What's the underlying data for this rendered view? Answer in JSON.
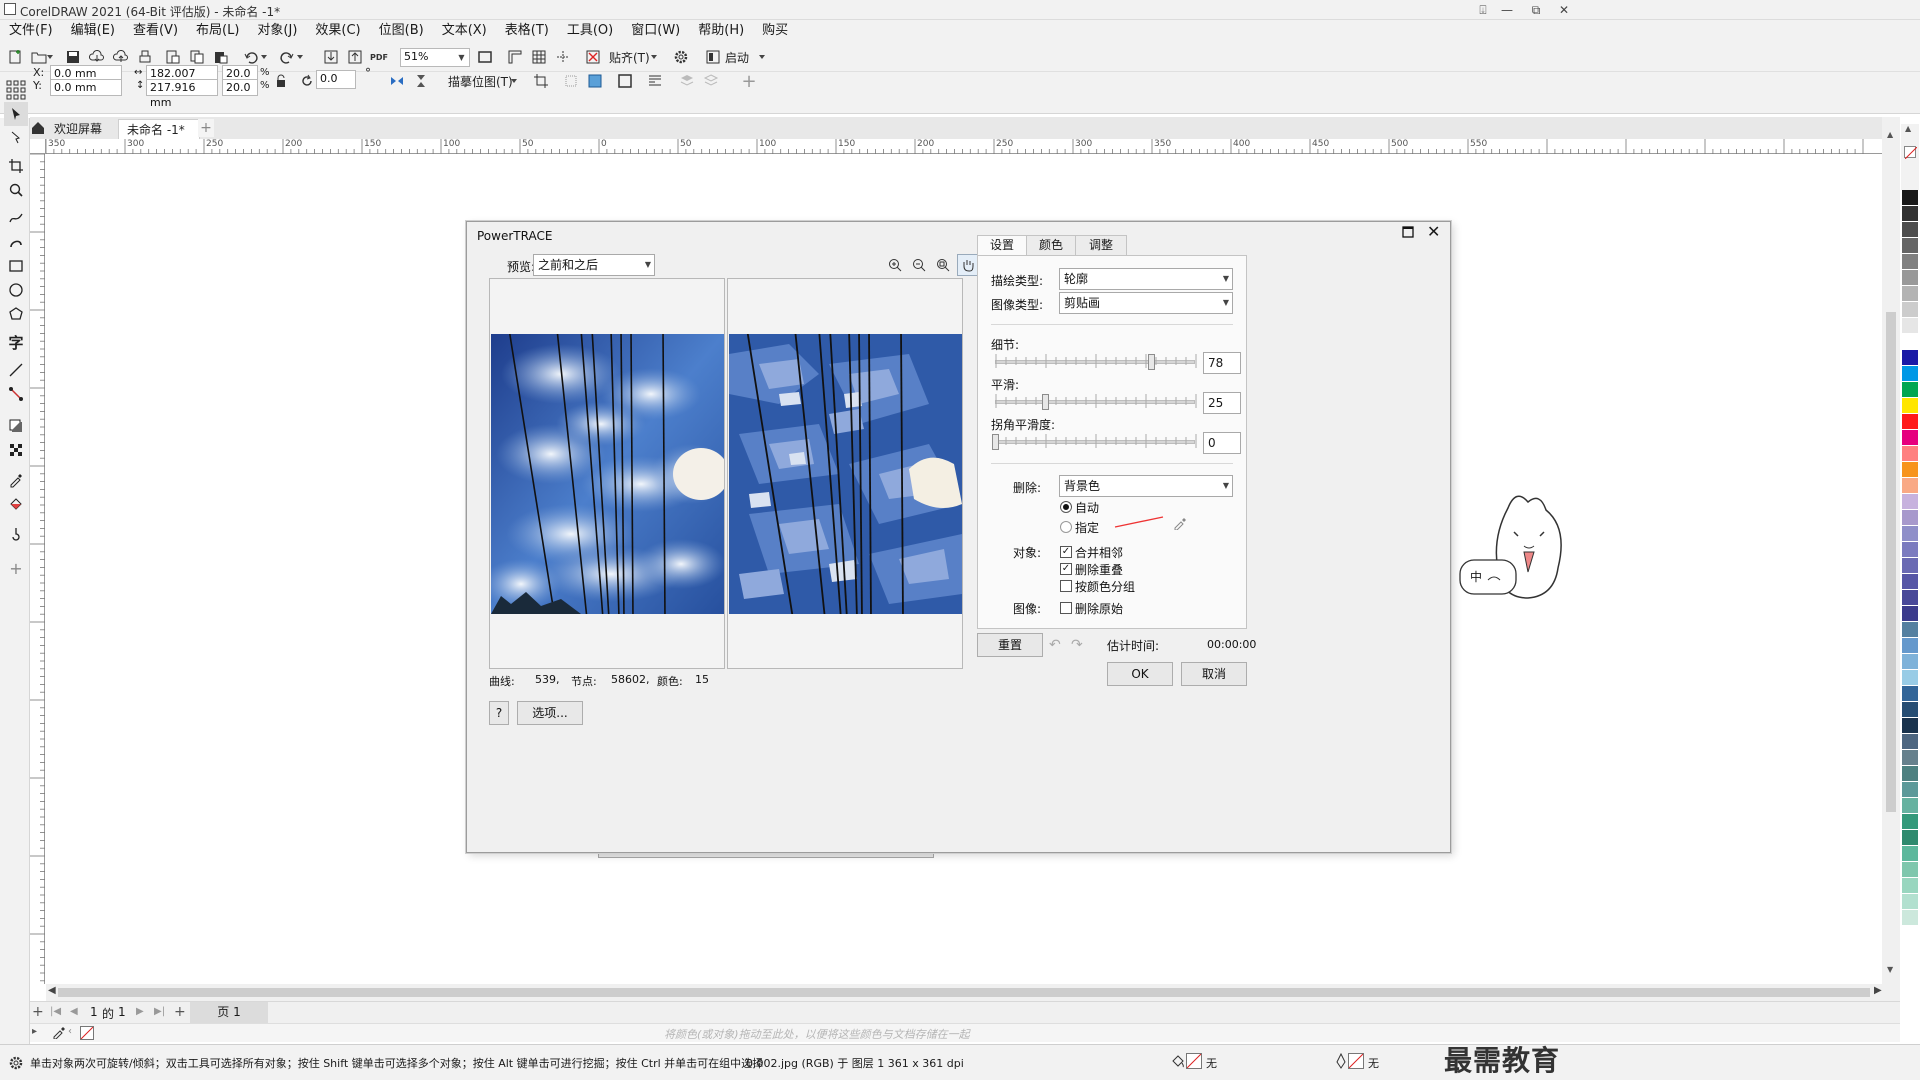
{
  "window": {
    "title": "CorelDRAW 2021 (64-Bit 评估版) - 未命名 -1*",
    "min_label": "—",
    "max_label": "☐",
    "close_label": "✕",
    "restore_label": "⧉"
  },
  "menu": [
    "文件(F)",
    "编辑(E)",
    "查看(V)",
    "布局(L)",
    "对象(J)",
    "效果(C)",
    "位图(B)",
    "文本(X)",
    "表格(T)",
    "工具(O)",
    "窗口(W)",
    "帮助(H)",
    "购买"
  ],
  "toolbar1": {
    "zoom": "51%",
    "snap_label": "贴齐(T)",
    "launch_label": "启动",
    "pdf_label": "PDF"
  },
  "toolbar2": {
    "x_label": "X:",
    "y_label": "Y:",
    "x_value": "0.0 mm",
    "y_value": "0.0 mm",
    "width_value": "182.007 mm",
    "height_value": "217.916 mm",
    "scale_w": "20.0",
    "scale_h": "20.0",
    "percent": "%",
    "rotation": "0.0",
    "degree": "°",
    "trace_label": "描摹位图(T)"
  },
  "doc_tabs": {
    "welcome": "欢迎屏幕",
    "doc": "未命名 -1*"
  },
  "ruler": {
    "h_labels": [
      "350",
      "300",
      "250",
      "200",
      "150",
      "100",
      "50",
      "0",
      "50",
      "100",
      "150",
      "200",
      "250",
      "300",
      "350",
      "400",
      "450",
      "500",
      "550"
    ],
    "unit": "毫米"
  },
  "dialog": {
    "title": "PowerTRACE",
    "preview_label": "预览:",
    "preview_value": "之前和之后",
    "tabs": [
      "设置",
      "颜色",
      "调整"
    ],
    "trace_type_label": "描绘类型:",
    "trace_type_value": "轮廓",
    "image_type_label": "图像类型:",
    "image_type_value": "剪贴画",
    "detail_label": "细节:",
    "detail_value": "78",
    "detail_level": 0.78,
    "smooth_label": "平滑:",
    "smooth_value": "25",
    "smooth_level": 0.25,
    "corner_label": "拐角平滑度:",
    "corner_value": "0",
    "corner_level": 0,
    "remove_label": "删除:",
    "remove_value": "背景色",
    "auto_label": "自动",
    "specify_label": "指定",
    "object_label": "对象:",
    "merge_label": "合并相邻",
    "remove_overlap_label": "删除重叠",
    "group_by_color_label": "按颜色分组",
    "image_label": "图像:",
    "remove_original_label": "删除原始",
    "stats": {
      "curves_label": "曲线:",
      "curves_value": "539,",
      "nodes_label": "节点:",
      "nodes_value": "58602,",
      "colors_label": "颜色:",
      "colors_value": "15"
    },
    "reset_label": "重置",
    "est_time_label": "估计时间:",
    "est_time_value": "00:00:00",
    "help_label": "?",
    "options_label": "选项...",
    "ok_label": "OK",
    "cancel_label": "取消"
  },
  "pagebar": {
    "page_num": "1",
    "of": "的",
    "total": "1",
    "page_tab": "页 1"
  },
  "palette_hint": "将颜色(或对象)拖动至此处，以便将这些颜色与文档存储在一起",
  "status": {
    "hint": "单击对象两次可旋转/倾斜；双击工具可选择所有对象；按住 Shift 键单击可选择多个对象；按住 Alt 键单击可进行挖掘；按住 Ctrl 并单击可在组中选择",
    "file_info": "0.002.jpg (RGB) 于 图层 1 361 x 361 dpi",
    "fill_none": "无",
    "outline_none": "无"
  },
  "watermark": "最需教育",
  "mascot_text": "中",
  "colors": {
    "accent": "#1a73c9",
    "palette": [
      "#1a1a1a",
      "#333333",
      "#4d4d4d",
      "#666666",
      "#808080",
      "#999999",
      "#b3b3b3",
      "#cccccc",
      "#e6e6e6",
      "#ffffff",
      "#1a1aa6",
      "#0099e6",
      "#00a651",
      "#ffe600",
      "#ff1a1a",
      "#e6007e",
      "#ff8080",
      "#f7941d",
      "#f9a985",
      "#c7b2de",
      "#a799cc",
      "#8f8fc9",
      "#7b7bbf",
      "#6a6ab3",
      "#5656a6",
      "#484899",
      "#3b3b8c",
      "#5580a0",
      "#6699cc",
      "#7fb2d9",
      "#99cce6",
      "#336699",
      "#264d73",
      "#1a334d",
      "#4d6680",
      "#66808c",
      "#4d8080",
      "#5c9999",
      "#66b2a0",
      "#33997a",
      "#2e8a6e",
      "#5cb89c",
      "#7fc7ad",
      "#99d6bf",
      "#b2e0cf",
      "#cce8dc"
    ]
  }
}
